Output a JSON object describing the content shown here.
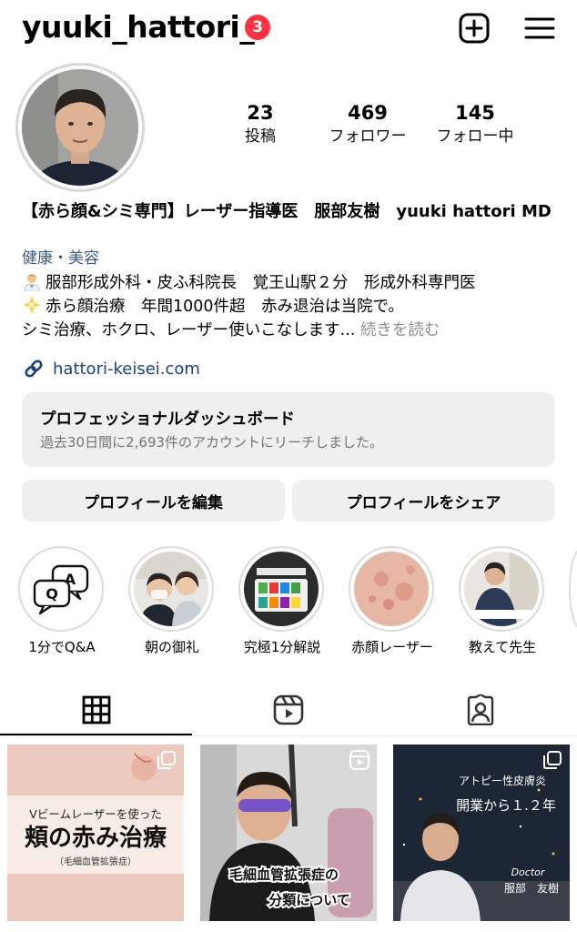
{
  "header": {
    "username": "yuuki_hattori_",
    "notification_count": "3",
    "icons": {
      "new_post": "plus-square-icon",
      "menu": "hamburger-menu-icon"
    }
  },
  "stats": [
    {
      "value": "23",
      "label": "投稿"
    },
    {
      "value": "469",
      "label": "フォロワー"
    },
    {
      "value": "145",
      "label": "フォロー中"
    }
  ],
  "bio": {
    "name": "【赤ら顔&シミ専門】レーザー指導医　服部友樹　yuuki hattori MD",
    "category": "健康・美容",
    "line1": "服部形成外科・皮ふ科院長　覚王山駅２分　形成外科専門医",
    "line1_emoji": "doctor-emoji",
    "line2": "赤ら顔治療　年間1000件超　赤み退治は当院で。",
    "line2_emoji": "sparkle-emoji",
    "line3": "シミ治療、ホクロ、レーザー使いこなします...",
    "more": "続きを読む",
    "link": "hattori-keisei.com"
  },
  "dashboard": {
    "title": "プロフェッショナルダッシュボード",
    "subtitle": "過去30日間に2,693件のアカウントにリーチしました。"
  },
  "buttons": {
    "edit_profile": "プロフィールを編集",
    "share_profile": "プロフィールをシェア"
  },
  "highlights": [
    {
      "label": "1分でQ&A"
    },
    {
      "label": "朝の御礼"
    },
    {
      "label": "究極1分解説"
    },
    {
      "label": "赤顔レーザー"
    },
    {
      "label": "教えて先生"
    }
  ],
  "posts": [
    {
      "line1": "Vビームレーザーを使った",
      "line2": "頬の赤み治療",
      "line3": "（毛細血管拡張症）"
    },
    {
      "line1": "毛細血管拡張症の",
      "line2": "分類について"
    },
    {
      "line1": "アトピー性皮膚炎",
      "line2": "開業から１.２年",
      "line3": "Doctor",
      "line4": "服部　友樹"
    }
  ],
  "colors": {
    "badge": "#ff3040",
    "category": "#3d5a80",
    "link": "#1c3f8a",
    "muted": "#737373"
  }
}
